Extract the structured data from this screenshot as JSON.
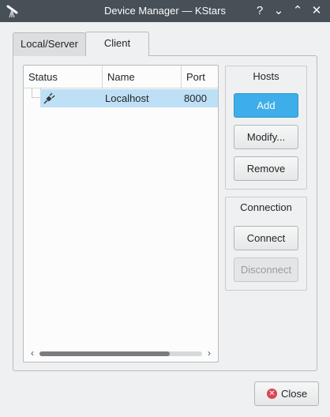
{
  "window": {
    "title": "Device Manager — KStars",
    "help_glyph": "?",
    "minimize_glyph": "⌄",
    "maximize_glyph": "⌃",
    "close_glyph": "✕",
    "app_icon": "telescope-icon"
  },
  "tabs": [
    {
      "label": "Local/Server",
      "active": false
    },
    {
      "label": "Client",
      "active": true
    }
  ],
  "table": {
    "columns": [
      "Status",
      "Name",
      "Port"
    ],
    "rows": [
      {
        "status_icon": "disconnected-plug-icon",
        "name": "Localhost",
        "port": "8000",
        "selected": true,
        "checked": false
      }
    ],
    "scroll_left_glyph": "‹",
    "scroll_right_glyph": "›",
    "scroll_thumb_fraction": 0.8
  },
  "hosts_group": {
    "title": "Hosts",
    "buttons": {
      "add": "Add",
      "modify": "Modify...",
      "remove": "Remove"
    }
  },
  "connection_group": {
    "title": "Connection",
    "buttons": {
      "connect": "Connect",
      "disconnect": "Disconnect"
    },
    "disconnect_enabled": false
  },
  "footer": {
    "close_label": "Close",
    "close_icon": "close-circle-icon",
    "close_glyph": "✕"
  },
  "colors": {
    "accent": "#3daee9",
    "selection": "#bde0f6",
    "titlebar": "#475057",
    "danger": "#da4453"
  }
}
